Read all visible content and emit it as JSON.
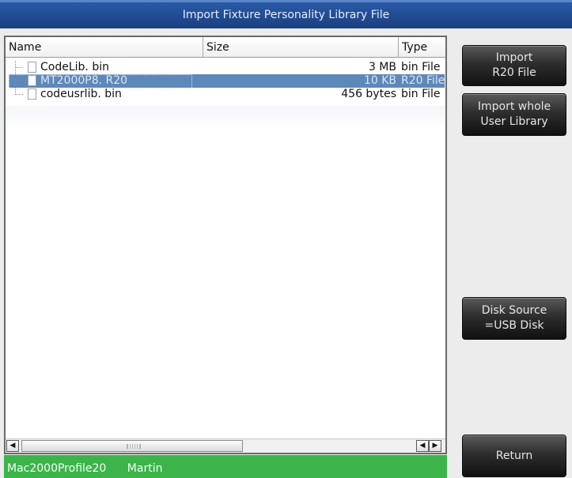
{
  "window": {
    "title": "Import Fixture Personality Library File"
  },
  "file_list": {
    "columns": [
      "Name",
      "Size",
      "Type"
    ],
    "rows": [
      {
        "name": "CodeLib. bin",
        "size": "3 MB",
        "type": "bin File",
        "selected": false
      },
      {
        "name": "MT2000P8. R20",
        "size": "10 KB",
        "type": "R20 File",
        "selected": true
      },
      {
        "name": "codeusrlib. bin",
        "size": "456 bytes",
        "type": "bin File",
        "selected": false
      }
    ]
  },
  "scrollbar": {
    "left_arrow": "◀",
    "right_arrow": "▶"
  },
  "status": {
    "profile": "Mac2000Profile20",
    "manufacturer": "Martin"
  },
  "buttons": {
    "import_r20": "Import\nR20 File",
    "import_user_library": "Import whole\nUser Library",
    "disk_source": "Disk Source\n=USB Disk",
    "return": "Return"
  },
  "colors": {
    "title_bar": "#1f4a8f",
    "selection": "#5d88ba",
    "status_bar": "#3cb44a",
    "button": "#2d2d2d"
  }
}
